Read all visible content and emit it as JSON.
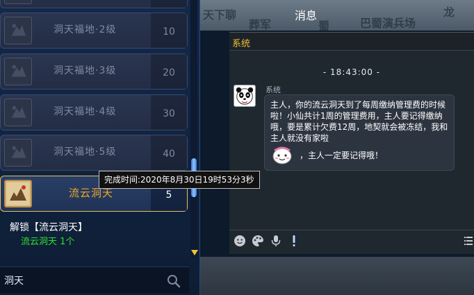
{
  "list": {
    "items": [
      {
        "label": "",
        "count": ""
      },
      {
        "label": "洞天福地·2级",
        "count": "10"
      },
      {
        "label": "洞天福地·3级",
        "count": "20"
      },
      {
        "label": "洞天福地·4级",
        "count": "30"
      },
      {
        "label": "洞天福地·5级",
        "count": "40"
      },
      {
        "label": "流云洞天",
        "count": "5"
      }
    ]
  },
  "unlock": {
    "title": "解锁【流云洞天】",
    "requirement": "流云洞天  1个"
  },
  "search": {
    "value": "洞天"
  },
  "tooltip": {
    "text": "完成时间:2020年8月30日19时53分3秒"
  },
  "scenery_text": [
    "天下聊",
    "葬军",
    "蜀",
    "巴蜀演兵场",
    "龙"
  ],
  "chat": {
    "title": "消息",
    "channel": "系统",
    "time": "- 18:43:00 -",
    "sender": "系统",
    "message": "主人，你的流云洞天到了每周缴纳管理费的时候啦！小仙共计1周的管理费用，主人要记得缴纳哦，要是累计欠费12周，地契就会被冻结，我和主人就没有家啦",
    "message_end": "，主人一定要记得哦！"
  },
  "colors": {
    "selected_border": "#e6c063",
    "selected_label": "#f0a82a",
    "requirement_green": "#2ee02e",
    "channel_yellow": "#f0c030"
  },
  "icons": [
    "item-thumbnail-icon",
    "search-icon",
    "panda-avatar-icon",
    "emoticon-icon",
    "smiley-icon",
    "palette-icon",
    "microphone-icon",
    "exclamation-icon",
    "menu-icon",
    "scroll-down-arrow-icon"
  ]
}
